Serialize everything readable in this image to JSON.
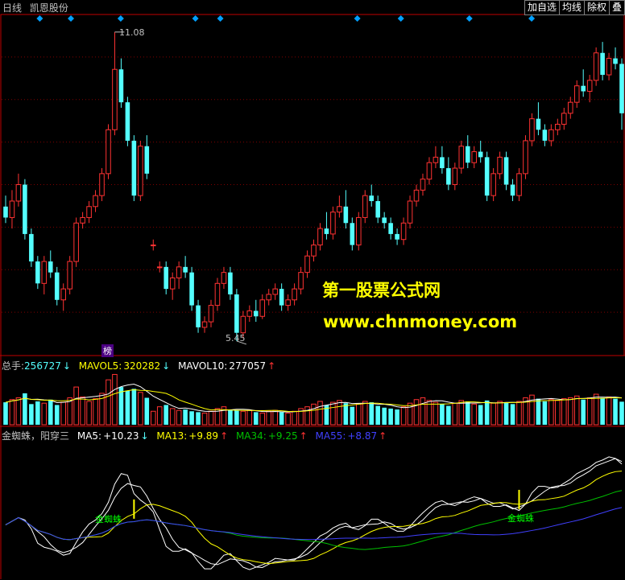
{
  "header": {
    "period": "日线",
    "stock_name": "凯恩股份",
    "buttons": [
      "加自选",
      "均线",
      "除权",
      "叠"
    ]
  },
  "price_panel": {
    "high_label": "11.08",
    "low_label": "5.45",
    "badge": "榜",
    "watermark_cn": "第一股票公式网",
    "watermark_url": "www.chnmoney.com"
  },
  "volume_panel": {
    "total_label": "总手:",
    "total_value": "256727",
    "mavol5_label": "MAVOL5:",
    "mavol5_value": "320282",
    "mavol10_label": "MAVOL10:",
    "mavol10_value": "277057"
  },
  "indicator_panel": {
    "name": "金蜘蛛，阳穿三",
    "ma5_label": "MA5:",
    "ma5_value": "+10.23",
    "ma13_label": "MA13:",
    "ma13_value": "+9.89",
    "ma34_label": "MA34:",
    "ma34_value": "+9.25",
    "ma55_label": "MA55:",
    "ma55_value": "+8.87",
    "signal_label_1": "金蜘蛛",
    "signal_label_2": "金蜘蛛"
  },
  "colors": {
    "up": "#ff3232",
    "down": "#54ffff",
    "ma5": "#ffffff",
    "ma13": "#ffff00",
    "ma34": "#00c000",
    "ma55": "#4040ff",
    "diamond": "#00a0ff",
    "border": "#c00000"
  },
  "chart_data": {
    "type": "candlestick",
    "price": {
      "ylim": [
        5.2,
        11.4
      ],
      "candles": [
        [
          7.9,
          8.1,
          7.6,
          7.7
        ],
        [
          7.7,
          8.2,
          7.5,
          8.0
        ],
        [
          8.0,
          8.5,
          7.9,
          8.3
        ],
        [
          8.3,
          8.4,
          7.3,
          7.4
        ],
        [
          7.4,
          7.5,
          6.8,
          6.9
        ],
        [
          6.9,
          7.0,
          6.4,
          6.5
        ],
        [
          6.5,
          7.0,
          6.3,
          6.9
        ],
        [
          6.9,
          7.1,
          6.6,
          6.7
        ],
        [
          6.7,
          6.8,
          6.1,
          6.2
        ],
        [
          6.2,
          6.5,
          6.0,
          6.4
        ],
        [
          6.4,
          7.0,
          6.3,
          6.9
        ],
        [
          6.9,
          7.7,
          6.8,
          7.6
        ],
        [
          7.6,
          7.8,
          7.5,
          7.7
        ],
        [
          7.7,
          8.0,
          7.6,
          7.9
        ],
        [
          7.9,
          8.2,
          7.8,
          8.1
        ],
        [
          8.1,
          8.6,
          8.0,
          8.5
        ],
        [
          8.5,
          9.4,
          8.4,
          9.3
        ],
        [
          9.3,
          11.08,
          9.2,
          10.4
        ],
        [
          10.4,
          10.6,
          9.7,
          9.8
        ],
        [
          9.8,
          9.9,
          9.0,
          9.1
        ],
        [
          9.1,
          9.2,
          8.0,
          8.1
        ],
        [
          8.1,
          9.1,
          8.0,
          9.0
        ],
        [
          9.0,
          9.2,
          8.4,
          8.5
        ],
        [
          7.2,
          7.3,
          7.1,
          7.2
        ],
        [
          6.8,
          6.9,
          6.7,
          6.8
        ],
        [
          6.8,
          6.9,
          6.3,
          6.4
        ],
        [
          6.4,
          6.7,
          6.2,
          6.6
        ],
        [
          6.6,
          6.9,
          6.4,
          6.8
        ],
        [
          6.8,
          7.0,
          6.6,
          6.7
        ],
        [
          6.7,
          6.8,
          6.0,
          6.1
        ],
        [
          6.1,
          6.2,
          5.6,
          5.7
        ],
        [
          5.7,
          5.9,
          5.6,
          5.8
        ],
        [
          5.8,
          6.2,
          5.7,
          6.1
        ],
        [
          6.1,
          6.6,
          6.0,
          6.5
        ],
        [
          6.5,
          6.8,
          6.4,
          6.7
        ],
        [
          6.7,
          6.8,
          6.2,
          6.3
        ],
        [
          6.3,
          6.4,
          5.45,
          5.6
        ],
        [
          5.6,
          6.0,
          5.5,
          5.9
        ],
        [
          5.9,
          6.1,
          5.8,
          6.0
        ],
        [
          6.0,
          6.2,
          5.8,
          5.9
        ],
        [
          5.9,
          6.3,
          5.85,
          6.2
        ],
        [
          6.2,
          6.4,
          6.1,
          6.3
        ],
        [
          6.3,
          6.5,
          6.2,
          6.4
        ],
        [
          6.4,
          6.5,
          6.0,
          6.1
        ],
        [
          6.1,
          6.3,
          6.0,
          6.2
        ],
        [
          6.2,
          6.5,
          6.1,
          6.4
        ],
        [
          6.4,
          6.8,
          6.3,
          6.7
        ],
        [
          6.7,
          7.1,
          6.6,
          7.0
        ],
        [
          7.0,
          7.3,
          6.9,
          7.2
        ],
        [
          7.2,
          7.6,
          7.1,
          7.5
        ],
        [
          7.5,
          7.8,
          7.3,
          7.4
        ],
        [
          7.4,
          7.9,
          7.3,
          7.8
        ],
        [
          7.8,
          8.1,
          7.7,
          7.9
        ],
        [
          7.9,
          8.2,
          7.5,
          7.6
        ],
        [
          7.6,
          7.7,
          7.1,
          7.2
        ],
        [
          7.2,
          7.8,
          7.1,
          7.7
        ],
        [
          7.7,
          8.2,
          7.6,
          8.1
        ],
        [
          8.1,
          8.3,
          7.9,
          8.0
        ],
        [
          8.0,
          8.1,
          7.6,
          7.7
        ],
        [
          7.7,
          7.8,
          7.5,
          7.6
        ],
        [
          7.6,
          7.7,
          7.3,
          7.4
        ],
        [
          7.4,
          7.5,
          7.2,
          7.3
        ],
        [
          7.3,
          7.7,
          7.2,
          7.6
        ],
        [
          7.6,
          8.1,
          7.5,
          8.0
        ],
        [
          8.0,
          8.3,
          7.9,
          8.2
        ],
        [
          8.2,
          8.5,
          8.1,
          8.4
        ],
        [
          8.4,
          8.8,
          8.3,
          8.7
        ],
        [
          8.7,
          9.0,
          8.6,
          8.8
        ],
        [
          8.8,
          9.0,
          8.5,
          8.6
        ],
        [
          8.6,
          8.8,
          8.2,
          8.3
        ],
        [
          8.3,
          8.7,
          8.2,
          8.6
        ],
        [
          8.6,
          9.1,
          8.5,
          9.0
        ],
        [
          9.0,
          9.2,
          8.6,
          8.7
        ],
        [
          8.7,
          9.0,
          8.6,
          8.9
        ],
        [
          8.9,
          9.1,
          8.7,
          8.8
        ],
        [
          8.8,
          8.9,
          8.0,
          8.1
        ],
        [
          8.1,
          8.6,
          8.0,
          8.5
        ],
        [
          8.5,
          8.9,
          8.4,
          8.8
        ],
        [
          8.8,
          8.9,
          8.2,
          8.3
        ],
        [
          8.3,
          8.4,
          8.0,
          8.1
        ],
        [
          8.1,
          8.6,
          8.0,
          8.5
        ],
        [
          8.5,
          9.2,
          8.4,
          9.1
        ],
        [
          9.1,
          9.6,
          9.0,
          9.5
        ],
        [
          9.5,
          9.8,
          9.2,
          9.3
        ],
        [
          9.3,
          9.4,
          9.0,
          9.1
        ],
        [
          9.1,
          9.4,
          9.0,
          9.3
        ],
        [
          9.3,
          9.5,
          9.2,
          9.4
        ],
        [
          9.4,
          9.7,
          9.3,
          9.6
        ],
        [
          9.6,
          9.9,
          9.5,
          9.8
        ],
        [
          9.8,
          10.2,
          9.7,
          10.1
        ],
        [
          10.1,
          10.4,
          9.9,
          10.0
        ],
        [
          10.0,
          10.3,
          9.8,
          10.2
        ],
        [
          10.2,
          10.8,
          10.1,
          10.7
        ],
        [
          10.7,
          10.9,
          10.2,
          10.3
        ],
        [
          10.3,
          10.7,
          10.2,
          10.6
        ],
        [
          10.6,
          10.8,
          10.4,
          10.5
        ],
        [
          10.5,
          10.6,
          9.3,
          9.6
        ]
      ]
    },
    "volume": {
      "ylim": [
        0,
        600000
      ],
      "values": [
        250,
        280,
        300,
        350,
        230,
        260,
        240,
        280,
        220,
        250,
        300,
        420,
        310,
        260,
        290,
        350,
        500,
        560,
        420,
        380,
        400,
        360,
        300,
        150,
        200,
        220,
        180,
        160,
        170,
        150,
        140,
        130,
        150,
        180,
        200,
        170,
        160,
        150,
        160,
        140,
        130,
        150,
        160,
        140,
        130,
        150,
        180,
        200,
        230,
        260,
        220,
        250,
        270,
        240,
        200,
        230,
        260,
        250,
        210,
        190,
        180,
        170,
        200,
        240,
        280,
        300,
        270,
        250,
        230,
        210,
        240,
        270,
        260,
        230,
        220,
        270,
        240,
        260,
        250,
        230,
        260,
        300,
        330,
        290,
        260,
        280,
        270,
        290,
        300,
        320,
        280,
        300,
        340,
        300,
        310,
        290,
        256.727
      ],
      "mavol5": 320282,
      "mavol10": 277057
    },
    "indicator": {
      "ylim": [
        5.5,
        11.2
      ],
      "signal_indices": [
        20,
        80
      ]
    }
  }
}
